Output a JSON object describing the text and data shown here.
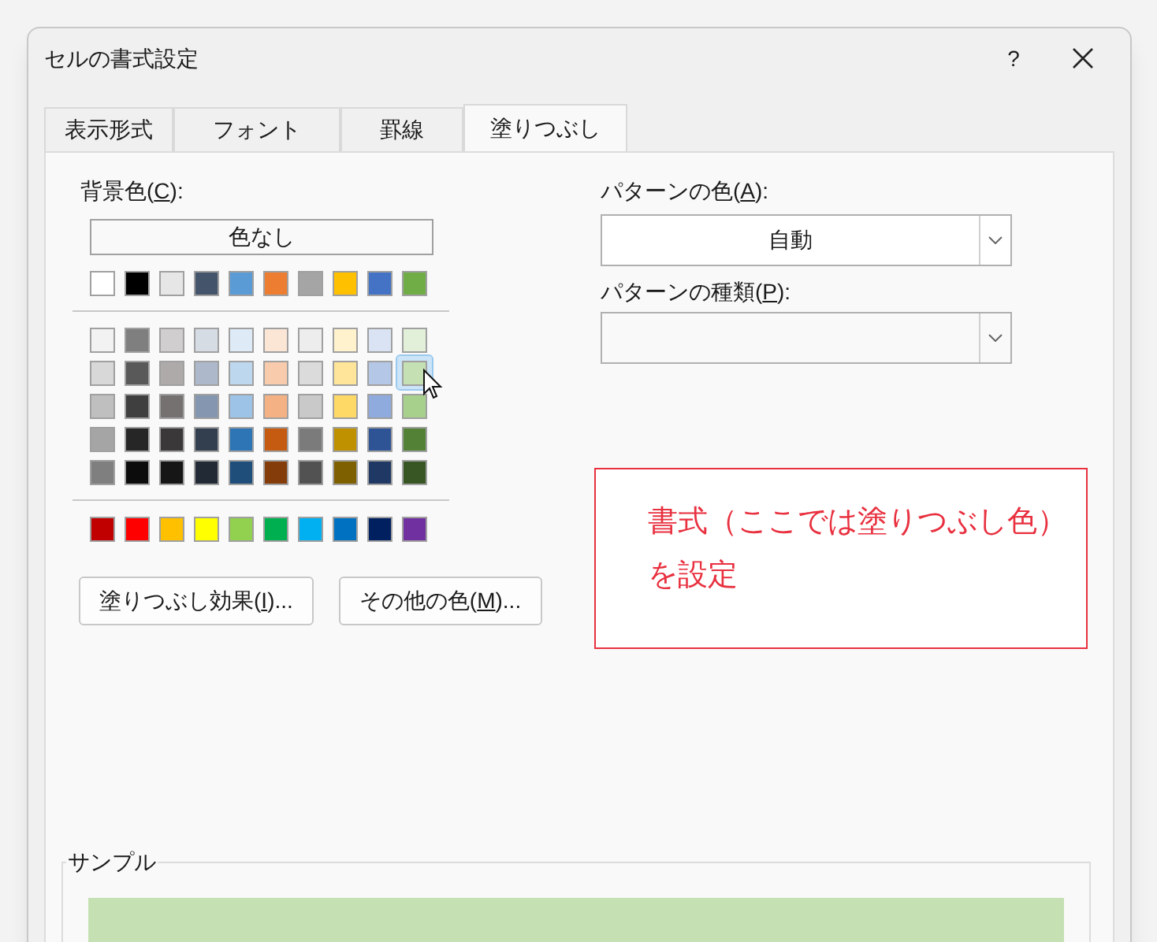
{
  "window": {
    "title": "セルの書式設定",
    "help": "?"
  },
  "tabs": [
    {
      "label": "表示形式",
      "selected": false
    },
    {
      "label": "フォント",
      "selected": false
    },
    {
      "label": "罫線",
      "selected": false
    },
    {
      "label": "塗りつぶし",
      "selected": true
    }
  ],
  "background_color": {
    "label": {
      "before": "背景色(",
      "key": "C",
      "after": "):"
    },
    "no_color_button": "色なし",
    "theme_row": [
      {
        "color": "#ffffff",
        "selected": false
      },
      {
        "color": "#000000",
        "selected": false
      },
      {
        "color": "#e7e6e6",
        "selected": false
      },
      {
        "color": "#44546a",
        "selected": false
      },
      {
        "color": "#5b9bd5",
        "selected": false
      },
      {
        "color": "#ed7d31",
        "selected": false
      },
      {
        "color": "#a5a5a5",
        "selected": false
      },
      {
        "color": "#ffc000",
        "selected": false
      },
      {
        "color": "#4472c4",
        "selected": false
      },
      {
        "color": "#70ad47",
        "selected": false
      }
    ],
    "tint_rows": [
      [
        {
          "color": "#f2f2f2",
          "selected": false
        },
        {
          "color": "#7f7f7f",
          "selected": false
        },
        {
          "color": "#d0cece",
          "selected": false
        },
        {
          "color": "#d6dce4",
          "selected": false
        },
        {
          "color": "#deebf6",
          "selected": false
        },
        {
          "color": "#fbe5d5",
          "selected": false
        },
        {
          "color": "#ededed",
          "selected": false
        },
        {
          "color": "#fff2cc",
          "selected": false
        },
        {
          "color": "#dae3f3",
          "selected": false
        },
        {
          "color": "#e2efd9",
          "selected": false
        }
      ],
      [
        {
          "color": "#d8d8d8",
          "selected": false
        },
        {
          "color": "#595959",
          "selected": false
        },
        {
          "color": "#aeaaaa",
          "selected": false
        },
        {
          "color": "#adb9ca",
          "selected": false
        },
        {
          "color": "#bdd7ee",
          "selected": false
        },
        {
          "color": "#f8cbad",
          "selected": false
        },
        {
          "color": "#dbdbdb",
          "selected": false
        },
        {
          "color": "#fee599",
          "selected": false
        },
        {
          "color": "#b4c7e7",
          "selected": false
        },
        {
          "color": "#c5e0b3",
          "selected": true
        }
      ],
      [
        {
          "color": "#bfbfbf",
          "selected": false
        },
        {
          "color": "#3f3f3f",
          "selected": false
        },
        {
          "color": "#757171",
          "selected": false
        },
        {
          "color": "#8496b0",
          "selected": false
        },
        {
          "color": "#9dc3e6",
          "selected": false
        },
        {
          "color": "#f4b183",
          "selected": false
        },
        {
          "color": "#c9c9c9",
          "selected": false
        },
        {
          "color": "#ffd965",
          "selected": false
        },
        {
          "color": "#8faadc",
          "selected": false
        },
        {
          "color": "#a8d08d",
          "selected": false
        }
      ],
      [
        {
          "color": "#a5a5a5",
          "selected": false
        },
        {
          "color": "#262626",
          "selected": false
        },
        {
          "color": "#3a3838",
          "selected": false
        },
        {
          "color": "#333f4f",
          "selected": false
        },
        {
          "color": "#2e75b5",
          "selected": false
        },
        {
          "color": "#c55a11",
          "selected": false
        },
        {
          "color": "#7b7b7b",
          "selected": false
        },
        {
          "color": "#bf9000",
          "selected": false
        },
        {
          "color": "#2f5496",
          "selected": false
        },
        {
          "color": "#538135",
          "selected": false
        }
      ],
      [
        {
          "color": "#7f7f7f",
          "selected": false
        },
        {
          "color": "#0c0c0c",
          "selected": false
        },
        {
          "color": "#171616",
          "selected": false
        },
        {
          "color": "#222a35",
          "selected": false
        },
        {
          "color": "#1e4e79",
          "selected": false
        },
        {
          "color": "#843c0b",
          "selected": false
        },
        {
          "color": "#525252",
          "selected": false
        },
        {
          "color": "#7f6000",
          "selected": false
        },
        {
          "color": "#203864",
          "selected": false
        },
        {
          "color": "#375623",
          "selected": false
        }
      ]
    ],
    "standard_row": [
      {
        "color": "#c00000",
        "selected": false
      },
      {
        "color": "#ff0000",
        "selected": false
      },
      {
        "color": "#ffc000",
        "selected": false
      },
      {
        "color": "#ffff00",
        "selected": false
      },
      {
        "color": "#92d050",
        "selected": false
      },
      {
        "color": "#00b050",
        "selected": false
      },
      {
        "color": "#00b0f0",
        "selected": false
      },
      {
        "color": "#0070c0",
        "selected": false
      },
      {
        "color": "#002060",
        "selected": false
      },
      {
        "color": "#7030a0",
        "selected": false
      }
    ]
  },
  "buttons": [
    {
      "before": "塗りつぶし効果(",
      "key": "I",
      "after": ")..."
    },
    {
      "before": "その他の色(",
      "key": "M",
      "after": ")..."
    }
  ],
  "pattern_color": {
    "label": {
      "before": "パターンの色(",
      "key": "A",
      "after": "):"
    },
    "value": "自動"
  },
  "pattern_style": {
    "label": {
      "before": "パターンの種類(",
      "key": "P",
      "after": "):"
    }
  },
  "annotation": {
    "lines": [
      "書式（ここでは塗りつぶし色）",
      "を設定"
    ]
  },
  "sample": {
    "label": "サンプル",
    "color": "#c5e0b3"
  }
}
